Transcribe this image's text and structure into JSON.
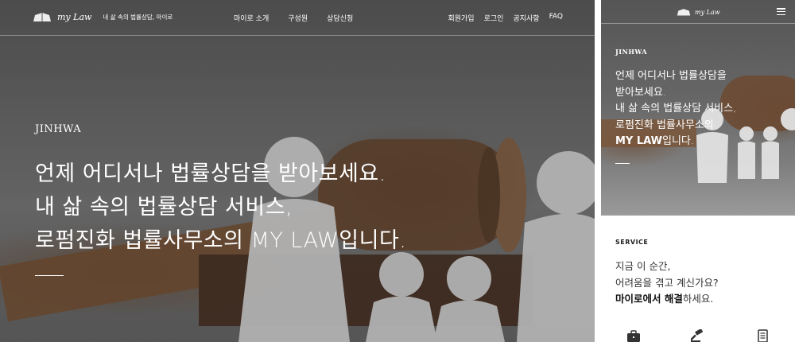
{
  "desktop": {
    "logo_text": "my Law",
    "tagline": "내 삶 속의 법률상담, 마이로",
    "nav": [
      "마이로 소개",
      "구성원",
      "상담신청"
    ],
    "util": [
      "회원가입",
      "로그인",
      "공지사항",
      "FAQ"
    ],
    "hero": {
      "eyebrow": "JINHWA",
      "line1": "언제 어디서나 법률상담을 받아보세요.",
      "line2": "내 삶 속의 법률상담 서비스,",
      "line3": "로펌진화 법률사무소의 MY LAW입니다."
    }
  },
  "mobile": {
    "logo_text": "my Law",
    "menu_icon": "hamburger-menu-icon",
    "hero": {
      "eyebrow": "JINHWA",
      "line1": "언제 어디서나 법률상담을",
      "line2": "받아보세요.",
      "line3": "내 삶 속의 법률상담 서비스,",
      "line4": "로펌진화 법률사무소의",
      "line5_bold": "MY LAW",
      "line5_rest": "입니다."
    },
    "service": {
      "eyebrow": "SERVICE",
      "line1": "지금 이 순간,",
      "line2": "어려움을 겪고 계신가요?",
      "line3_bold": "마이로에서 해결",
      "line3_rest": "하세요."
    },
    "icons": [
      "briefcase-icon",
      "gavel-icon",
      "document-icon"
    ]
  }
}
